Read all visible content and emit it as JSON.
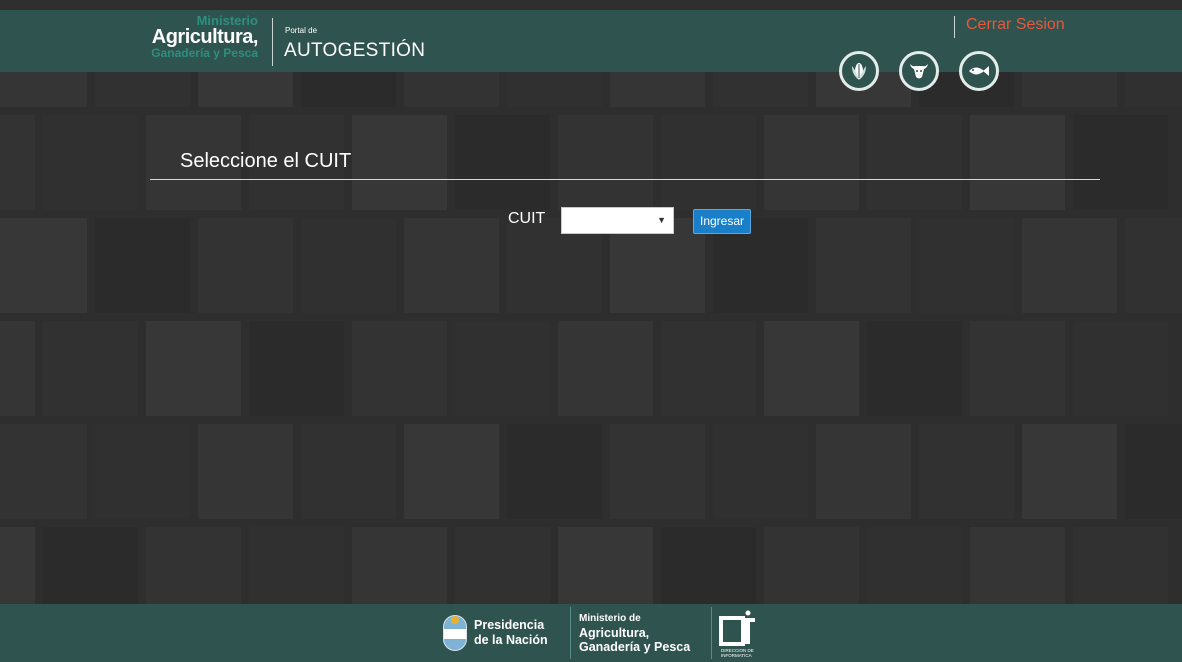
{
  "header": {
    "logo": {
      "line1": "Ministerio",
      "line2": "Agricultura,",
      "line3": "Ganadería y Pesca"
    },
    "portal_small": "Portal de",
    "portal_title": "AUTOGESTIÓN",
    "logout_label": "Cerrar Sesion",
    "icons": [
      "corn-icon",
      "cow-icon",
      "fish-icon"
    ]
  },
  "main": {
    "title": "Seleccione el CUIT",
    "cuit_label": "CUIT",
    "cuit_selected": "",
    "submit_label": "Ingresar"
  },
  "footer": {
    "presidencia_line1": "Presidencia",
    "presidencia_line2": "de la Nación",
    "ministerio_line1": "Ministerio de",
    "ministerio_line2": "Agricultura,",
    "ministerio_line3": "Ganadería y Pesca",
    "di_line1": "DIRECCION DE",
    "di_line2": "INFORMATICA"
  },
  "colors": {
    "header_bg": "#2f5450",
    "logout": "#e8573a",
    "button": "#1a7fc9",
    "page_bg": "#2f2f2f"
  }
}
